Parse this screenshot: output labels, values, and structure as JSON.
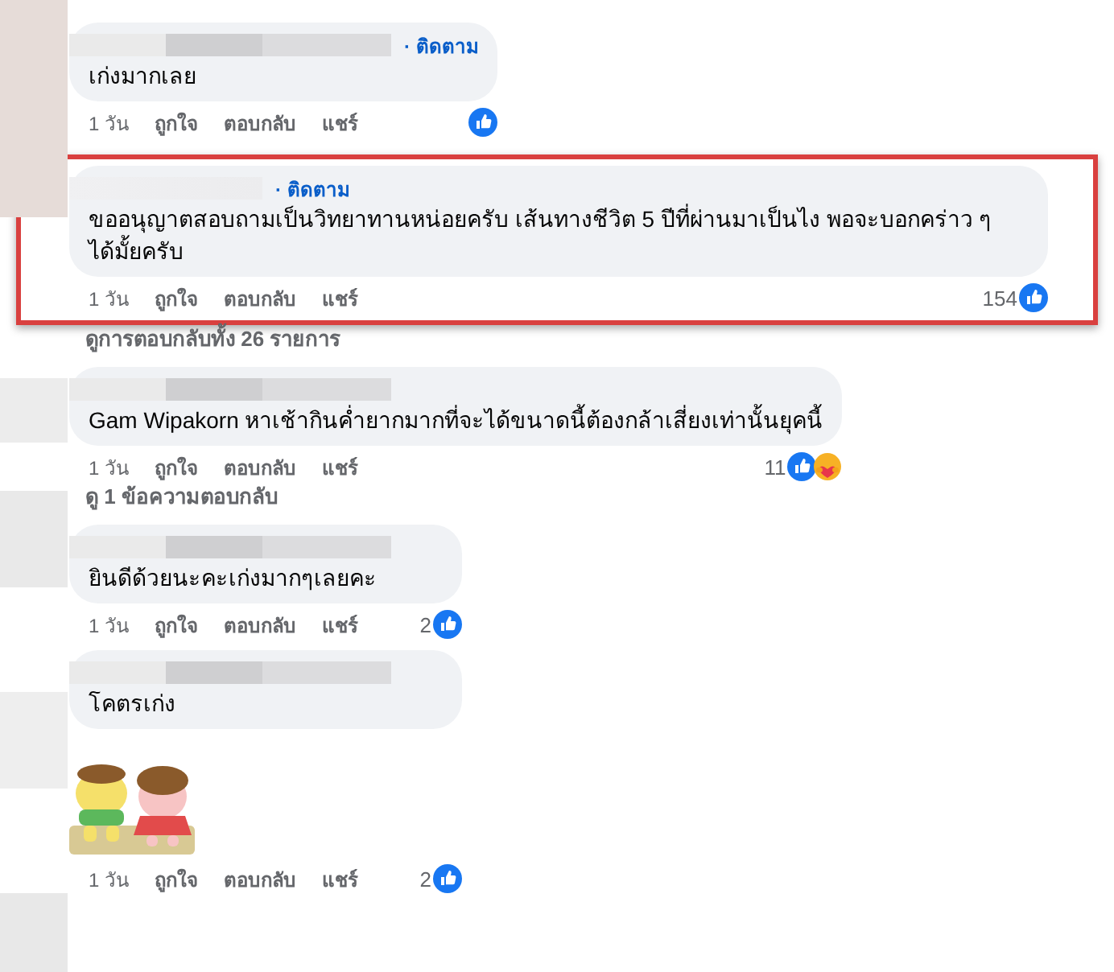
{
  "items": [
    {
      "kind": "comment",
      "highlighted": false,
      "follow": "· ติดตาม",
      "text": "เก่งมากเลย",
      "time": "1 วัน",
      "actions": [
        "ถูกใจ",
        "ตอบกลับ",
        "แชร์"
      ],
      "reactions": [
        {
          "kind": "like"
        }
      ]
    },
    {
      "kind": "comment",
      "highlighted": true,
      "follow": "· ติดตาม",
      "text": "ขออนุญาตสอบถามเป็นวิทยาทานหน่อยครับ เส้นทางชีวิต 5 ปีที่ผ่านมาเป็นไง พอจะบอกคร่าว ๆ ได้มั้ยครับ",
      "time": "1 วัน",
      "actions": [
        "ถูกใจ",
        "ตอบกลับ",
        "แชร์"
      ],
      "reaction_count": "154",
      "reactions": [
        {
          "kind": "like"
        }
      ]
    },
    {
      "kind": "link",
      "text": "ดูการตอบกลับทั้ง 26 รายการ"
    },
    {
      "kind": "comment",
      "highlighted": false,
      "text": "Gam Wipakorn หาเช้ากินค่ำยากมากที่จะได้ขนาดนี้ต้องกล้าเสี่ยงเท่านั้นยุคนี้",
      "time": "1 วัน",
      "actions": [
        "ถูกใจ",
        "ตอบกลับ",
        "แชร์"
      ],
      "reaction_count": "11",
      "reactions": [
        {
          "kind": "like"
        },
        {
          "kind": "care"
        }
      ]
    },
    {
      "kind": "link",
      "text": "ดู 1 ข้อความตอบกลับ"
    },
    {
      "kind": "comment",
      "highlighted": false,
      "text": "ยินดีด้วยนะคะเก่งมากๆเลยคะ",
      "time": "1 วัน",
      "actions": [
        "ถูกใจ",
        "ตอบกลับ",
        "แชร์"
      ],
      "reaction_count": "2",
      "reactions": [
        {
          "kind": "like"
        }
      ]
    },
    {
      "kind": "comment",
      "highlighted": false,
      "text": "โคตรเก่ง",
      "sticker": {
        "kind": "picture"
      },
      "time": "1 วัน",
      "actions": [
        "ถูกใจ",
        "ตอบกลับ",
        "แชร์"
      ],
      "reaction_count": "2",
      "reactions": [
        {
          "kind": "like"
        }
      ]
    }
  ]
}
